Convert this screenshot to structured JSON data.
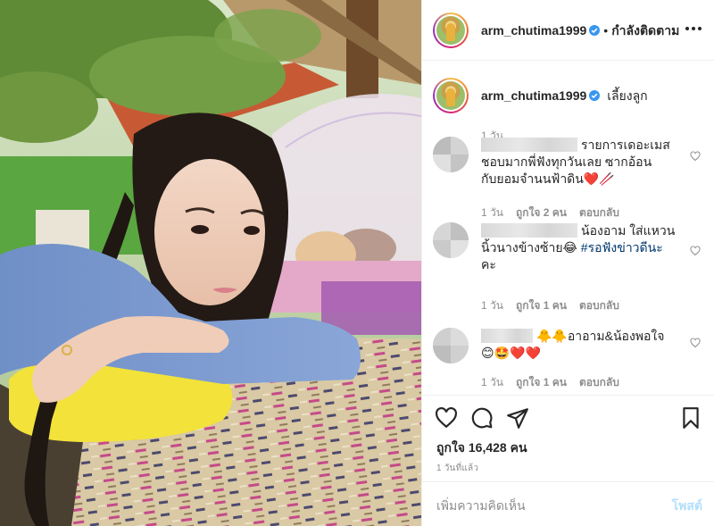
{
  "header": {
    "username": "arm_chutima1999",
    "separator": "•",
    "follow_status": "กำลังติดตาม",
    "more_icon": "more-horizontal-icon",
    "verified_icon": "verified-badge-icon"
  },
  "caption": {
    "username": "arm_chutima1999",
    "text": "เลี้ยงลูก",
    "time": "1 วัน"
  },
  "comments": [
    {
      "lines": [
        "รายการเดอะเมส",
        "ชอบมากพี่ฟังทุกวันเลย ซากอ้อน",
        "กับยอมจำนนฟ้าดิน❤️🥢"
      ],
      "time": "1 วัน",
      "likes": "ถูกใจ 2 คน",
      "reply": "ตอบกลับ"
    },
    {
      "lines": [
        "น้องอาม ใส่แหวน",
        "นิ้วนางข้างซ้าย😂 ",
        "คะ"
      ],
      "hashtag": "#รอฟังข่าวดีนะ",
      "time": "1 วัน",
      "likes": "ถูกใจ 1 คน",
      "reply": "ตอบกลับ"
    },
    {
      "lines": [
        "🐥🐥อาอาม&น้องพอใจ",
        "😊🤩❤️❤️"
      ],
      "time": "1 วัน",
      "likes": "ถูกใจ 1 คน",
      "reply": "ตอบกลับ"
    }
  ],
  "actions": {
    "like_icon": "heart-icon",
    "comment_icon": "comment-icon",
    "share_icon": "share-icon",
    "save_icon": "bookmark-icon",
    "likes_label": "ถูกใจ 16,428 คน",
    "posted": "1 วันที่แล้ว"
  },
  "add_comment": {
    "placeholder": "เพิ่มความคิดเห็น",
    "post_label": "โพสต์"
  },
  "colors": {
    "text": "#262626",
    "muted": "#8e8e8e",
    "border": "#efefef",
    "link": "#00376b",
    "post_disabled": "#b2dffc"
  }
}
